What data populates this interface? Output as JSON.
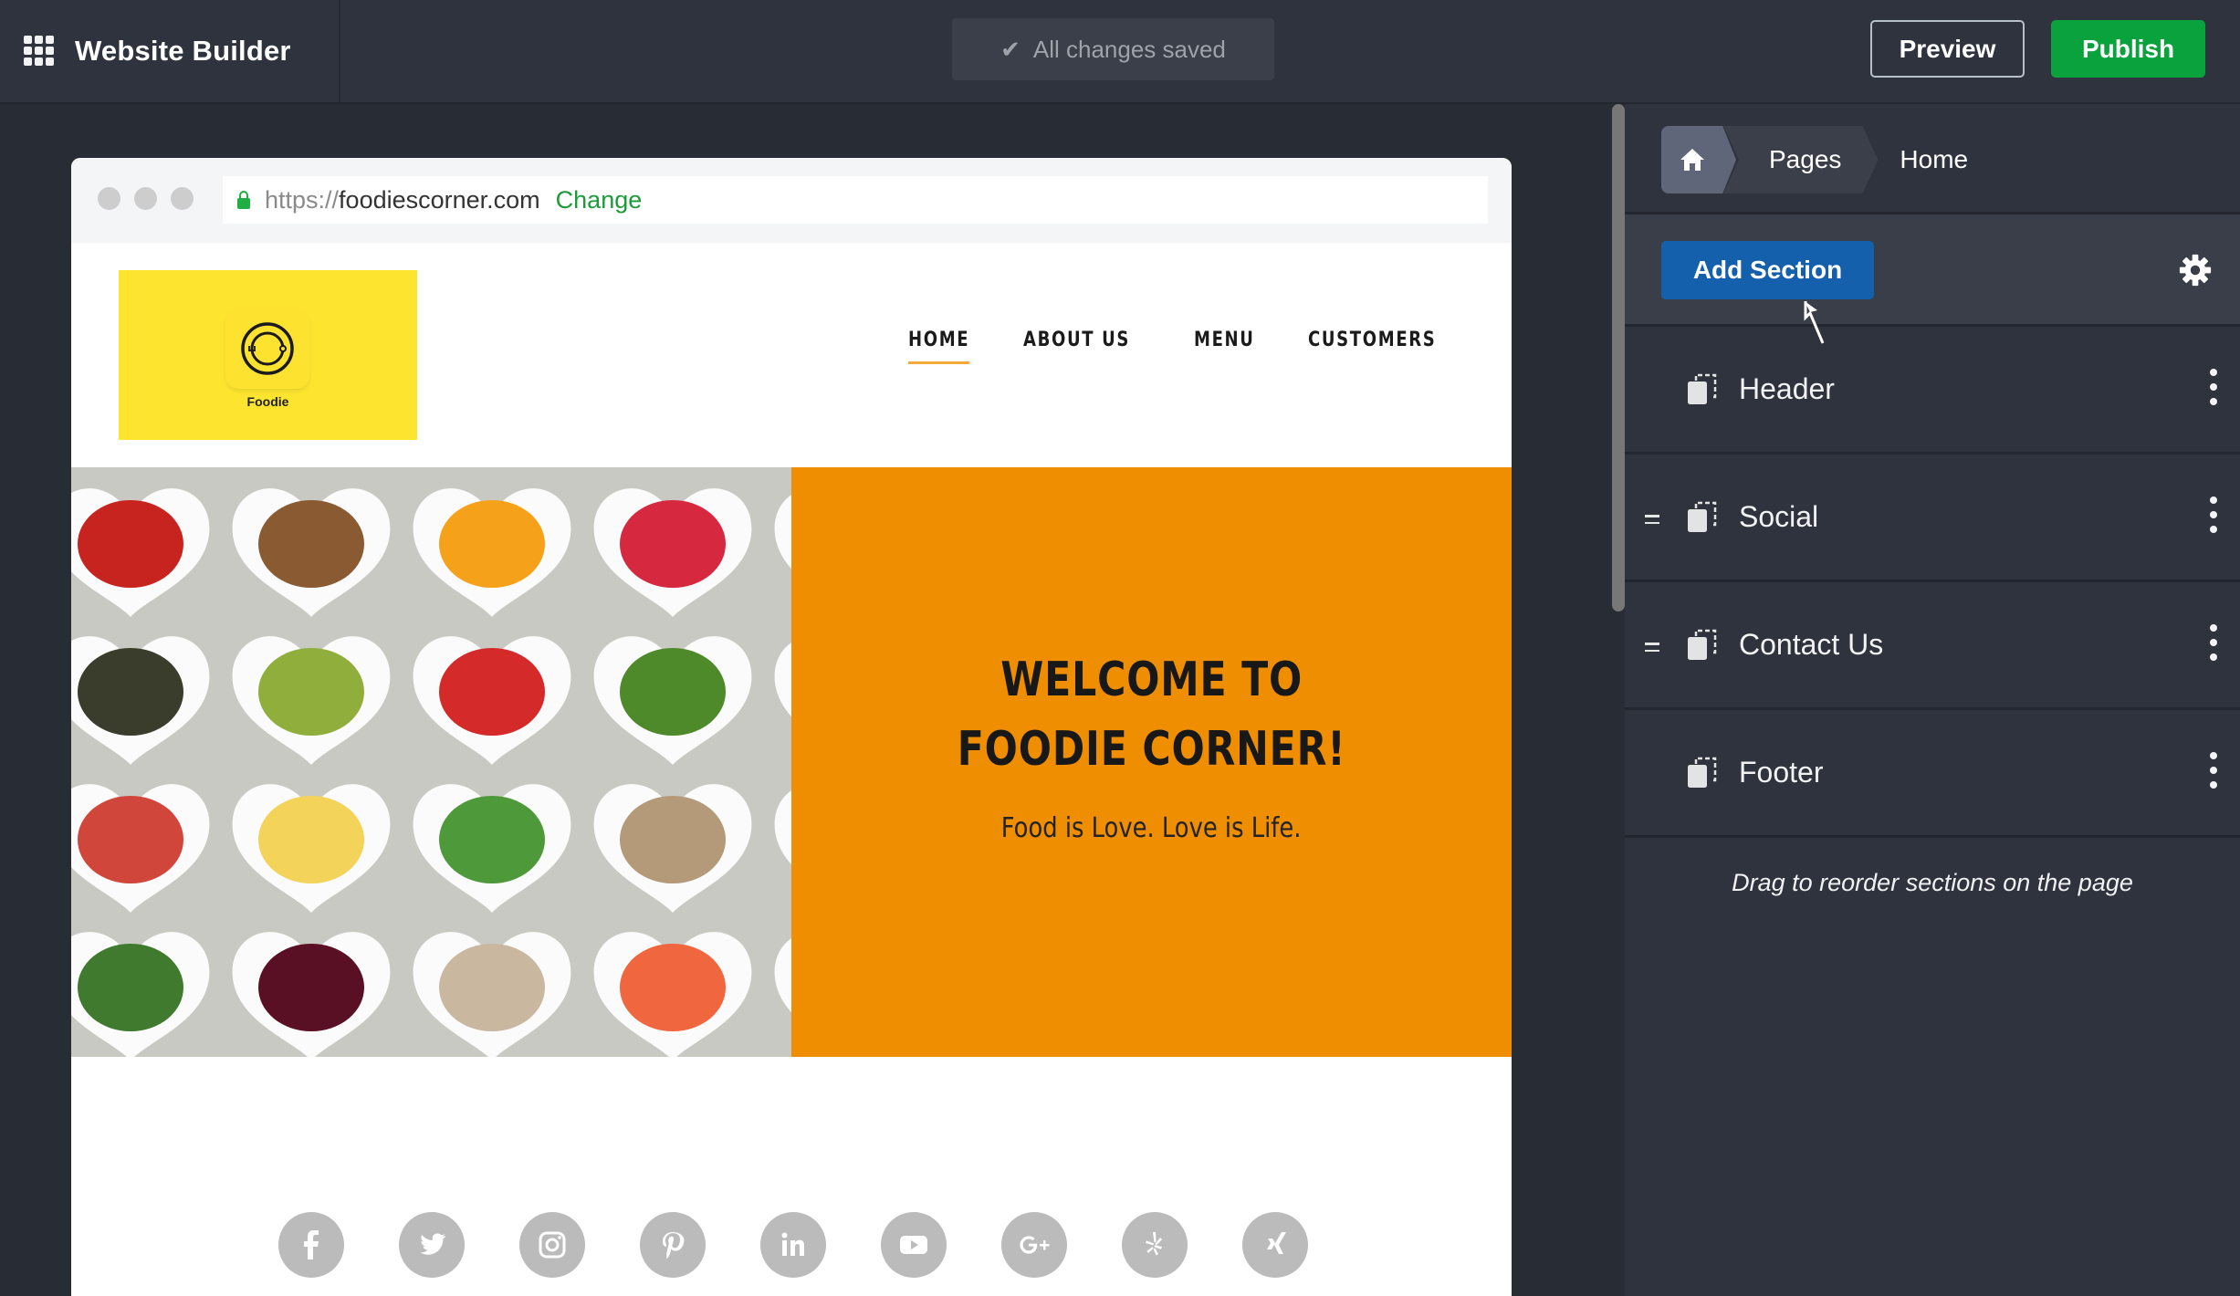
{
  "app": {
    "title": "Website Builder",
    "save_status": "All changes saved",
    "preview_label": "Preview",
    "publish_label": "Publish",
    "publish_color": "#09a23c"
  },
  "browser": {
    "url_protocol": "https://",
    "url_host": "foodiescorner.com",
    "change_label": "Change"
  },
  "site": {
    "logo_text": "Foodie",
    "logo_bg": "#fde52f",
    "nav": [
      {
        "label": "HOME",
        "active": true
      },
      {
        "label": "ABOUT US",
        "active": false
      },
      {
        "label": "MENU",
        "active": false
      },
      {
        "label": "CUSTOMERS",
        "active": false
      }
    ],
    "hero": {
      "title_line1": "WELCOME TO",
      "title_line2": "FOODIE CORNER!",
      "subtitle": "Food is Love. Love is Life.",
      "bg_color": "#ee8e00",
      "image_alt": "heart-shaped bowls of fruits, vegetables, nuts and grains"
    },
    "social_icons": [
      "facebook-icon",
      "twitter-icon",
      "instagram-icon",
      "pinterest-icon",
      "linkedin-icon",
      "youtube-icon",
      "google-plus-icon",
      "yelp-icon",
      "xing-icon"
    ]
  },
  "panel": {
    "breadcrumb": {
      "home_icon": "home-icon",
      "pages": "Pages",
      "current": "Home"
    },
    "add_section_label": "Add Section",
    "settings_icon": "gear-icon",
    "sections": [
      {
        "label": "Header",
        "draggable": false
      },
      {
        "label": "Social",
        "draggable": true
      },
      {
        "label": "Contact Us",
        "draggable": true
      },
      {
        "label": "Footer",
        "draggable": false
      }
    ],
    "hint": "Drag to reorder sections on the page"
  }
}
